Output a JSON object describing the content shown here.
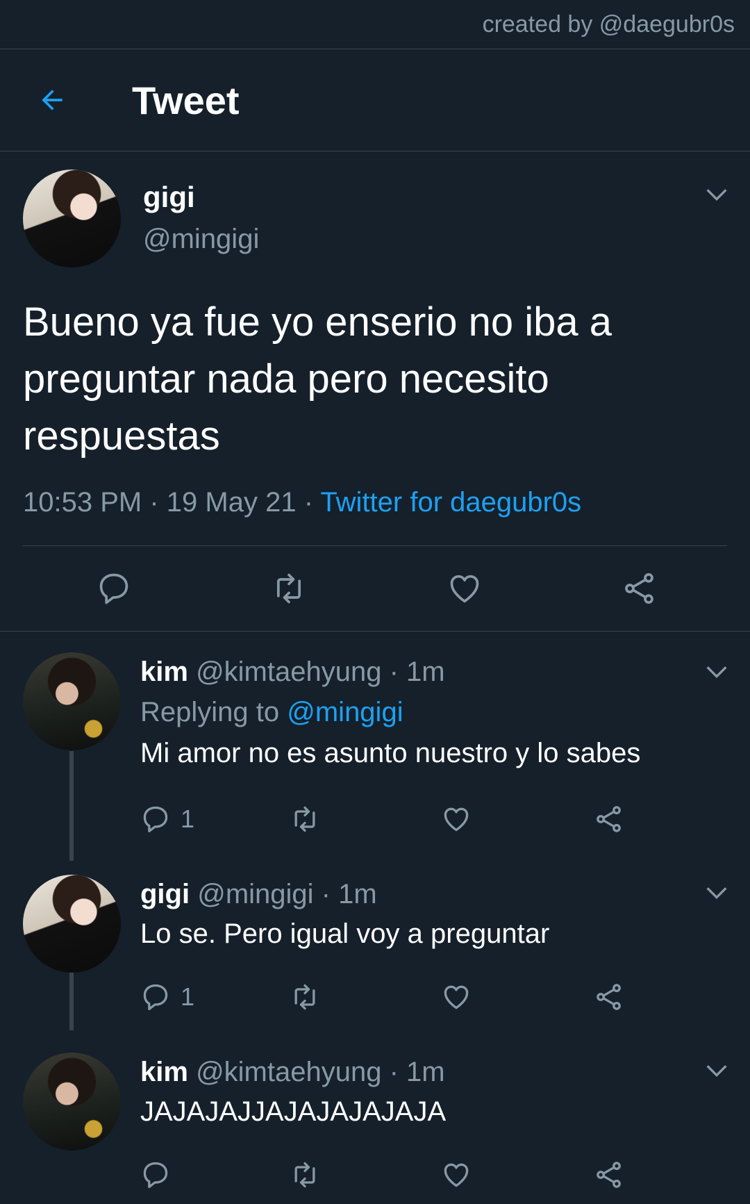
{
  "credit": "created by @daegubr0s",
  "header": {
    "title": "Tweet",
    "back_icon": "back-arrow-icon"
  },
  "colors": {
    "background": "#15202b",
    "accent": "#1da1f2",
    "secondary_text": "#8899a6",
    "divider": "#38444d"
  },
  "main_tweet": {
    "name": "gigi",
    "handle": "@mingigi",
    "text": "Bueno ya fue yo enserio no iba a preguntar nada pero necesito respuestas",
    "time": "10:53 PM",
    "sep1": "·",
    "date": "19 May 21",
    "sep2": "·",
    "source": "Twitter for daegubr0s"
  },
  "replies": [
    {
      "name": "kim",
      "handle": "@kimtaehyung",
      "dot": "·",
      "time": "1m",
      "replying_label": "Replying to",
      "replying_to": "@mingigi",
      "text": "Mi amor no es asunto nuestro y lo sabes",
      "reply_count": "1"
    },
    {
      "name": "gigi",
      "handle": "@mingigi",
      "dot": "·",
      "time": "1m",
      "text": "Lo se. Pero igual voy a preguntar",
      "reply_count": "1"
    },
    {
      "name": "kim",
      "handle": "@kimtaehyung",
      "dot": "·",
      "time": "1m",
      "text": "JAJAJAJJAJAJAJAJAJA",
      "reply_count": ""
    }
  ]
}
